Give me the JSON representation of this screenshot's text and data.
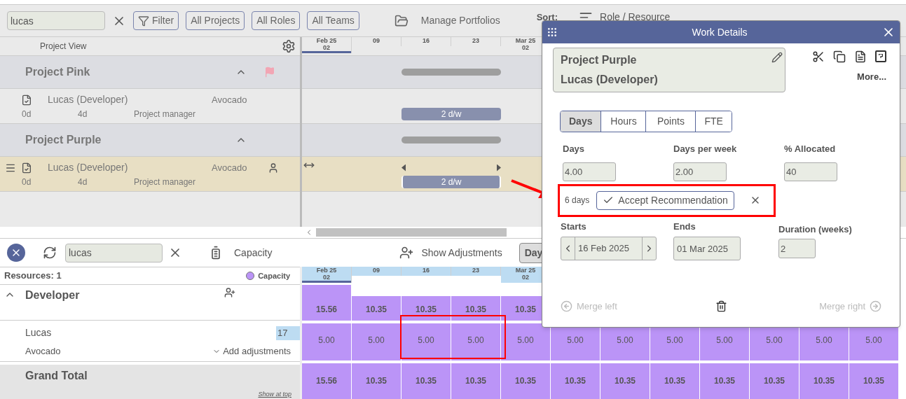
{
  "toolbar": {
    "search": "lucas",
    "filters": [
      "Filter",
      "All Projects",
      "All Roles",
      "All Teams"
    ],
    "portfolios": "Manage Portfolios",
    "sort_label": "Sort:",
    "sort_value": "Role / Resource"
  },
  "project_view": {
    "header": "Project View",
    "weeks": [
      {
        "month": "Feb 25",
        "day": "02",
        "current": true
      },
      {
        "day": "09",
        "current": false
      },
      {
        "day": "16",
        "current": false
      },
      {
        "day": "23",
        "current": false
      },
      {
        "month": "Mar 25",
        "day": "02",
        "current": false
      }
    ],
    "projects": [
      {
        "name": "Project Pink",
        "expanded": true,
        "flagged": true,
        "assignments": [
          {
            "name": "Lucas (Developer)",
            "client": "Avocado",
            "start": "0d",
            "effort": "4d",
            "role": "Project manager",
            "bar_label": "2 d/w",
            "selected": false
          }
        ]
      },
      {
        "name": "Project Purple",
        "expanded": true,
        "flagged": false,
        "assignments": [
          {
            "name": "Lucas (Developer)",
            "client": "Avocado",
            "start": "0d",
            "effort": "4d",
            "role": "Project manager",
            "bar_label": "2 d/w",
            "selected": true
          }
        ]
      }
    ]
  },
  "resource_view": {
    "search": "lucas",
    "capacity": "Capacity",
    "adjustments": "Show Adjustments",
    "view_button": "Day",
    "count": "Resources: 1",
    "legend": {
      "label": "Capacity",
      "color": "#bb94f7"
    },
    "weeks": [
      {
        "month": "Feb 25",
        "day": "02",
        "current": true
      },
      {
        "day": "09",
        "current": false
      },
      {
        "day": "16",
        "current": false
      },
      {
        "day": "23",
        "current": false
      },
      {
        "month": "Mar 25",
        "day": "02",
        "current": false
      }
    ],
    "group": {
      "name": "Developer",
      "expanded": true,
      "values": [
        "15.56",
        "10.35",
        "10.35",
        "10.35",
        "10.35"
      ]
    },
    "resource": {
      "name": "Lucas",
      "team": "Avocado",
      "badge": "17",
      "add": "Add adjustments",
      "values": [
        "5.00",
        "5.00",
        "5.00",
        "5.00",
        "5.00",
        "5.00",
        "5.00",
        "5.00",
        "5.00",
        "5.00",
        "5.00",
        "5.00"
      ]
    },
    "total": {
      "name": "Grand Total",
      "link": "Show at top",
      "values": [
        "15.56",
        "10.35",
        "10.35",
        "10.35",
        "10.35",
        "10.35",
        "10.35",
        "10.35",
        "10.35",
        "10.35",
        "10.35",
        "10.35"
      ]
    }
  },
  "dialog": {
    "title": "Work Details",
    "project": "Project Purple",
    "resource": "Lucas (Developer)",
    "more": "More...",
    "units": [
      {
        "label": "Days",
        "selected": true
      },
      {
        "label": "Hours",
        "selected": false
      },
      {
        "label": "Points",
        "selected": false
      },
      {
        "label": "FTE",
        "selected": false
      }
    ],
    "fields": [
      {
        "label": "Days",
        "value": "4.00"
      },
      {
        "label": "Days per week",
        "value": "2.00"
      },
      {
        "label": "% Allocated",
        "value": "40"
      }
    ],
    "recommendation": {
      "text": "6 days",
      "button": "Accept Recommendation"
    },
    "starts": {
      "label": "Starts",
      "value": "16 Feb 2025"
    },
    "ends": {
      "label": "Ends",
      "value": "01 Mar 2025"
    },
    "duration": {
      "label": "Duration (weeks)",
      "value": "2"
    },
    "merge_left": {
      "label": "Merge left",
      "disabled": true
    },
    "merge_right": {
      "label": "Merge right",
      "disabled": true
    }
  }
}
